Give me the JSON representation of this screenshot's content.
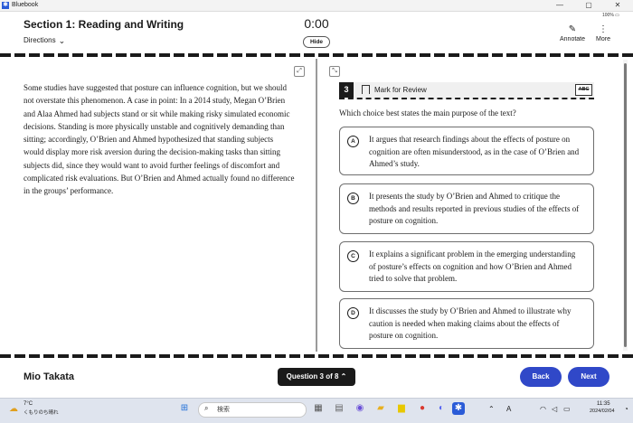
{
  "window": {
    "app_name": "Bluebook",
    "logo_glyph": "✱",
    "minimize": "—",
    "maximize": "▢",
    "close": "✕",
    "battery": "100% ▭"
  },
  "header": {
    "section_title": "Section 1: Reading and Writing",
    "directions_label": "Directions",
    "directions_chevron": "⌄",
    "timer": "0:00",
    "hide_label": "Hide",
    "annotate_label": "Annotate",
    "annotate_glyph": "✎",
    "more_label": "More",
    "more_glyph": "⋮"
  },
  "passage": {
    "text": "Some studies have suggested that posture can influence cognition, but we should not overstate this phenomenon. A case in point: In a 2014 study, Megan O’Brien and Alaa Ahmed had subjects stand or sit while making risky simulated economic decisions. Standing is more physically unstable and cognitively demanding than sitting; accordingly, O’Brien and Ahmed hypothesized that standing subjects would display more risk aversion during the decision-making tasks than sitting subjects did, since they would want to avoid further feelings of discomfort and complicated risk evaluations. But O’Brien and Ahmed actually found no difference in the groups’ performance.",
    "expand_glyph": "⤢",
    "collapse_glyph": "⤡"
  },
  "question": {
    "number": "3",
    "mark_label": "Mark for Review",
    "eliminator_label": "ABC",
    "prompt": "Which choice best states the main purpose of the text?",
    "choices": [
      {
        "letter": "A",
        "text": "It argues that research findings about the effects of posture on cognition are often misunderstood, as in the case of O’Brien and Ahmed’s study."
      },
      {
        "letter": "B",
        "text": "It presents the study by O’Brien and Ahmed to critique the methods and results reported in previous studies of the effects of posture on cognition."
      },
      {
        "letter": "C",
        "text": "It explains a significant problem in the emerging understanding of posture’s effects on cognition and how O’Brien and Ahmed tried to solve that problem."
      },
      {
        "letter": "D",
        "text": "It discusses the study by O’Brien and Ahmed to illustrate why caution is needed when making claims about the effects of posture on cognition."
      }
    ]
  },
  "footer": {
    "student_name": "Mio Takata",
    "question_nav": "Question 3 of 8 ⌃",
    "back_label": "Back",
    "next_label": "Next"
  },
  "taskbar": {
    "weather_glyph": "☁",
    "weather_temp": "7°C",
    "weather_desc": "くもりのち晴れ",
    "search_glyph": "⌕",
    "search_placeholder": "検索",
    "tray_chevron": "⌃",
    "tray_ime": "A",
    "tray_wifi": "◠",
    "tray_volume": "◁",
    "tray_battery": "▭",
    "clock_time": "11:35",
    "clock_date": "2024/02/04",
    "bell_glyph": "◔",
    "icon_glyphs": {
      "start": "⊞",
      "widgets": "▦",
      "files": "▤",
      "chat": "◉",
      "explorer": "▰",
      "notes": "▆",
      "chrome": "●",
      "discord": "◐",
      "bluebook": "✱"
    }
  },
  "colors": {
    "accent": "#3048c8",
    "dark": "#1a1a1a",
    "taskbar": "#dfe4ee"
  }
}
